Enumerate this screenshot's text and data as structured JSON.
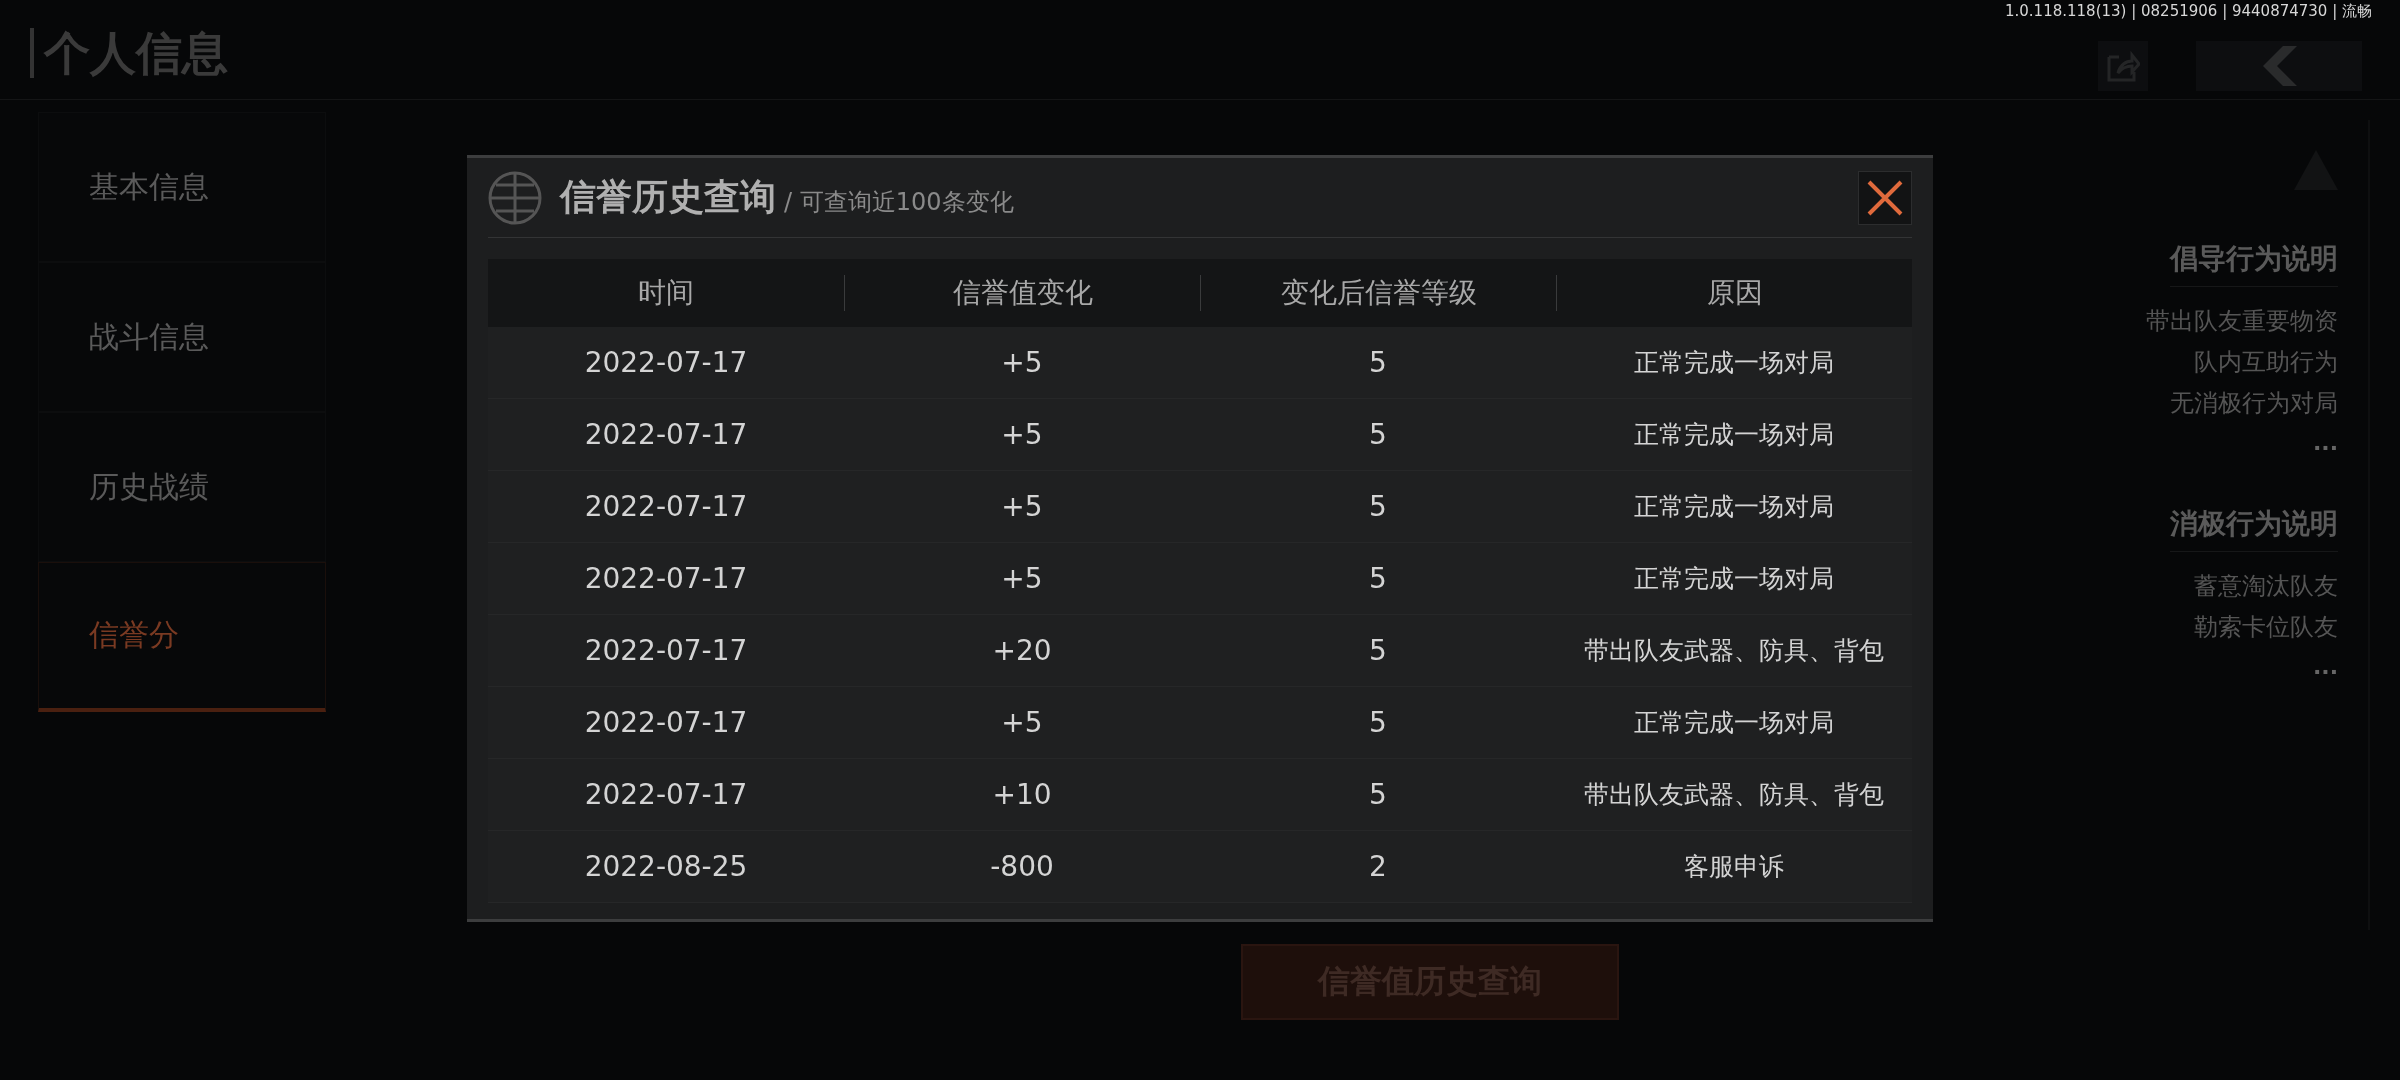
{
  "status_text": "1.0.118.118(13) | 08251906 | 9440874730 | 流畅",
  "page_title": "个人信息",
  "sidebar": {
    "items": [
      {
        "label": "基本信息",
        "selected": false
      },
      {
        "label": "战斗信息",
        "selected": false
      },
      {
        "label": "历史战绩",
        "selected": false
      },
      {
        "label": "信誉分",
        "selected": true
      }
    ]
  },
  "rules_panel": {
    "sections": [
      {
        "title": "倡导行为说明",
        "items": [
          "带出队友重要物资",
          "队内互助行为",
          "无消极行为对局"
        ],
        "more": "..."
      },
      {
        "title": "消极行为说明",
        "items": [
          "蓄意淘汰队友",
          "勒索卡位队友"
        ],
        "more": "..."
      }
    ]
  },
  "history_button": "信誉值历史查询",
  "dialog": {
    "title": "信誉历史查询",
    "subtitle": "/ 可查询近100条变化",
    "columns": [
      "时间",
      "信誉值变化",
      "变化后信誉等级",
      "原因"
    ],
    "rows": [
      [
        "2022-07-17",
        "+5",
        "5",
        "正常完成一场对局"
      ],
      [
        "2022-07-17",
        "+5",
        "5",
        "正常完成一场对局"
      ],
      [
        "2022-07-17",
        "+5",
        "5",
        "正常完成一场对局"
      ],
      [
        "2022-07-17",
        "+5",
        "5",
        "正常完成一场对局"
      ],
      [
        "2022-07-17",
        "+20",
        "5",
        "带出队友武器、防具、背包"
      ],
      [
        "2022-07-17",
        "+5",
        "5",
        "正常完成一场对局"
      ],
      [
        "2022-07-17",
        "+10",
        "5",
        "带出队友武器、防具、背包"
      ],
      [
        "2022-08-25",
        "-800",
        "2",
        "客服申诉"
      ]
    ]
  }
}
